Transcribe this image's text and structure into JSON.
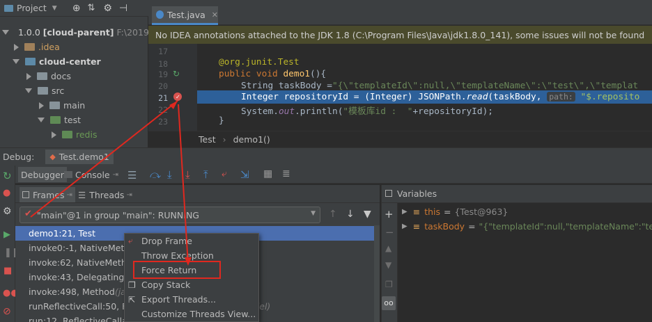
{
  "project_panel": {
    "title": "Project",
    "tree": [
      {
        "label": "1.0.0",
        "bold_suffix": "[cloud-parent]",
        "extra": "F:\\2019\\",
        "level": 0,
        "expanded": true,
        "kind": "module"
      },
      {
        "label": ".idea",
        "level": 1,
        "expanded": false,
        "kind": "folder-orange"
      },
      {
        "label": "cloud-center",
        "level": 1,
        "expanded": true,
        "kind": "module"
      },
      {
        "label": "docs",
        "level": 2,
        "expanded": false,
        "kind": "folder"
      },
      {
        "label": "src",
        "level": 2,
        "expanded": true,
        "kind": "folder"
      },
      {
        "label": "main",
        "level": 3,
        "expanded": false,
        "kind": "folder"
      },
      {
        "label": "test",
        "level": 3,
        "expanded": true,
        "kind": "folder-green"
      },
      {
        "label": "redis",
        "level": 4,
        "expanded": false,
        "kind": "package"
      }
    ]
  },
  "editor": {
    "tab_label": "Test.java",
    "notice": "No IDEA annotations attached to the JDK 1.8 (C:\\Program Files\\Java\\jdk1.8.0_141), some issues will not be found",
    "line_numbers": [
      "17",
      "18",
      "19",
      "20",
      "21",
      "22",
      "23"
    ],
    "code": {
      "l18_annotation": "@org.junit.Test",
      "l19_kw": "public void ",
      "l19_name": "demo1",
      "l19_rest": "(){",
      "l20_type": "String taskBody =",
      "l20_str": "\"{\\\"templateId\\\":null,\\\"templateName\\\":\\\"test\\\",\\\"templat",
      "l21_code": "Integer repositoryId = (Integer) JSONPath.",
      "l21_method": "read",
      "l21_args": "(taskBody,",
      "l21_hint": "path:",
      "l21_str": "\"$.reposito",
      "l22_a": "System.",
      "l22_out": "out",
      "l22_b": ".println(",
      "l22_str": "\"模板库id :  \"",
      "l22_c": "+repositoryId);",
      "l23": "}"
    },
    "breadcrumbs": [
      "Test",
      "demo1()"
    ]
  },
  "debug": {
    "title": "Debug:",
    "session_tab": "Test.demo1",
    "tabs": [
      "Debugger",
      "Console"
    ],
    "frames_tab": "Frames",
    "threads_tab": "Threads",
    "thread_select": "\"main\"@1 in group \"main\": RUNNING",
    "frames": [
      {
        "text": "demo1:21, Test",
        "pkg": "",
        "selected": true
      },
      {
        "text": "invoke0:-1, NativeMetho",
        "pkg": "",
        "selected": false
      },
      {
        "text": "invoke:62, NativeMetho",
        "pkg": "",
        "selected": false
      },
      {
        "text": "invoke:43, DelegatingM",
        "pkg": "",
        "selected": false
      },
      {
        "text": "invoke:498, Method ",
        "pkg": "(ja",
        "selected": false
      },
      {
        "text": "runReflectiveCall:50, Fra",
        "pkg": "ers.model)",
        "selected": false
      },
      {
        "text": "run:12, ReflectiveCallab",
        "pkg": ")",
        "selected": false
      }
    ],
    "variables_title": "Variables",
    "variables": [
      {
        "name": "this",
        "value": "{Test@963}"
      },
      {
        "name": "taskBody",
        "value": "\"{\"templateId\":null,\"templateName\":\"test\",\"te"
      }
    ],
    "context_menu": [
      {
        "label": "Drop Frame",
        "icon": "drop-frame-icon"
      },
      {
        "label": "Throw Exception",
        "icon": ""
      },
      {
        "label": "Force Return",
        "icon": ""
      },
      {
        "label": "Copy Stack",
        "icon": "copy-icon"
      },
      {
        "label": "Export Threads...",
        "icon": "export-icon"
      },
      {
        "label": "Customize Threads View...",
        "icon": ""
      }
    ]
  },
  "colors": {
    "annotation_box": "#e0281f",
    "selection": "#2d6099",
    "frame_selected": "#4b6eaf"
  }
}
